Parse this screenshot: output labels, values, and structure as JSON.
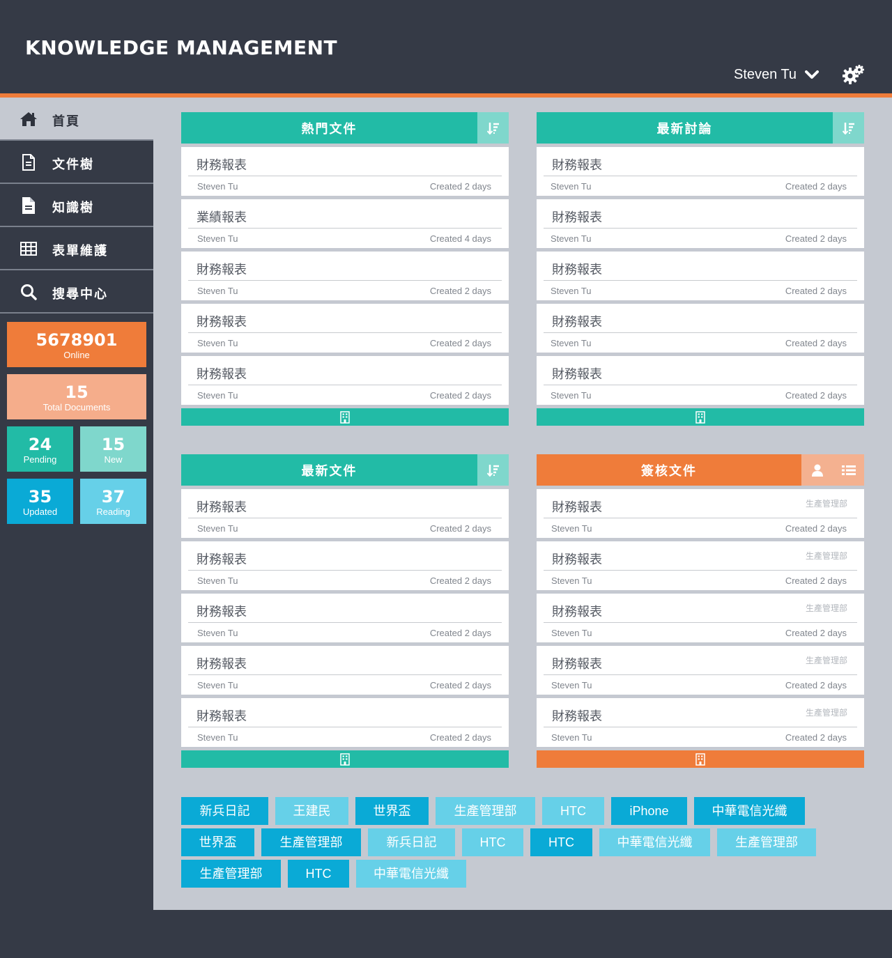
{
  "app": {
    "title": "KNOWLEDGE MANAGEMENT"
  },
  "header": {
    "user_name": "Steven Tu",
    "settings_icon": "gears-icon",
    "dropdown_icon": "chevron-down-icon"
  },
  "colors": {
    "teal": "#22bba6",
    "orange": "#ef7c3a",
    "navy": "#353a46",
    "blue": "#0aaad6"
  },
  "sidebar": {
    "items": [
      {
        "label": "首頁",
        "icon": "home-icon"
      },
      {
        "label": "文件樹",
        "icon": "document-outline-icon"
      },
      {
        "label": "知識樹",
        "icon": "document-filled-icon"
      },
      {
        "label": "表單維護",
        "icon": "table-icon"
      },
      {
        "label": "搜尋中心",
        "icon": "search-icon"
      }
    ],
    "stats": {
      "online": {
        "value": "5678901",
        "label": "Online"
      },
      "total": {
        "value": "15",
        "label": "Total Documents"
      },
      "pending": {
        "value": "24",
        "label": "Pending"
      },
      "new": {
        "value": "15",
        "label": "New"
      },
      "updated": {
        "value": "35",
        "label": "Updated"
      },
      "reading": {
        "value": "37",
        "label": "Reading"
      }
    }
  },
  "panels": {
    "hot_docs": {
      "title": "熱門文件",
      "items": [
        {
          "title": "財務報表",
          "author": "Steven Tu",
          "created": "Created 2 days"
        },
        {
          "title": "業績報表",
          "author": "Steven Tu",
          "created": "Created 4 days"
        },
        {
          "title": "財務報表",
          "author": "Steven Tu",
          "created": "Created 2 days"
        },
        {
          "title": "財務報表",
          "author": "Steven Tu",
          "created": "Created 2 days"
        },
        {
          "title": "財務報表",
          "author": "Steven Tu",
          "created": "Created 2 days"
        }
      ]
    },
    "latest_discussions": {
      "title": "最新討論",
      "items": [
        {
          "title": "財務報表",
          "author": "Steven Tu",
          "created": "Created 2 days"
        },
        {
          "title": "財務報表",
          "author": "Steven Tu",
          "created": "Created 2 days"
        },
        {
          "title": "財務報表",
          "author": "Steven Tu",
          "created": "Created 2 days"
        },
        {
          "title": "財務報表",
          "author": "Steven Tu",
          "created": "Created 2 days"
        },
        {
          "title": "財務報表",
          "author": "Steven Tu",
          "created": "Created 2 days"
        }
      ]
    },
    "latest_docs": {
      "title": "最新文件",
      "items": [
        {
          "title": "財務報表",
          "author": "Steven Tu",
          "created": "Created 2 days"
        },
        {
          "title": "財務報表",
          "author": "Steven Tu",
          "created": "Created 2 days"
        },
        {
          "title": "財務報表",
          "author": "Steven Tu",
          "created": "Created 2 days"
        },
        {
          "title": "財務報表",
          "author": "Steven Tu",
          "created": "Created 2 days"
        },
        {
          "title": "財務報表",
          "author": "Steven Tu",
          "created": "Created 2 days"
        }
      ]
    },
    "signoff_docs": {
      "title": "簽核文件",
      "items": [
        {
          "title": "財務報表",
          "dept": "生產管理部",
          "author": "Steven Tu",
          "created": "Created 2 days"
        },
        {
          "title": "財務報表",
          "dept": "生產管理部",
          "author": "Steven Tu",
          "created": "Created 2 days"
        },
        {
          "title": "財務報表",
          "dept": "生產管理部",
          "author": "Steven Tu",
          "created": "Created 2 days"
        },
        {
          "title": "財務報表",
          "dept": "生產管理部",
          "author": "Steven Tu",
          "created": "Created 2 days"
        },
        {
          "title": "財務報表",
          "dept": "生產管理部",
          "author": "Steven Tu",
          "created": "Created 2 days"
        }
      ]
    }
  },
  "tags": [
    "新兵日記",
    "王建民",
    "世界盃",
    "生產管理部",
    "HTC",
    "iPhone",
    "中華電信光纖",
    "世界盃",
    "生產管理部",
    "新兵日記",
    "HTC",
    "HTC",
    "中華電信光纖",
    "生產管理部",
    "生產管理部",
    "HTC",
    "中華電信光纖"
  ]
}
